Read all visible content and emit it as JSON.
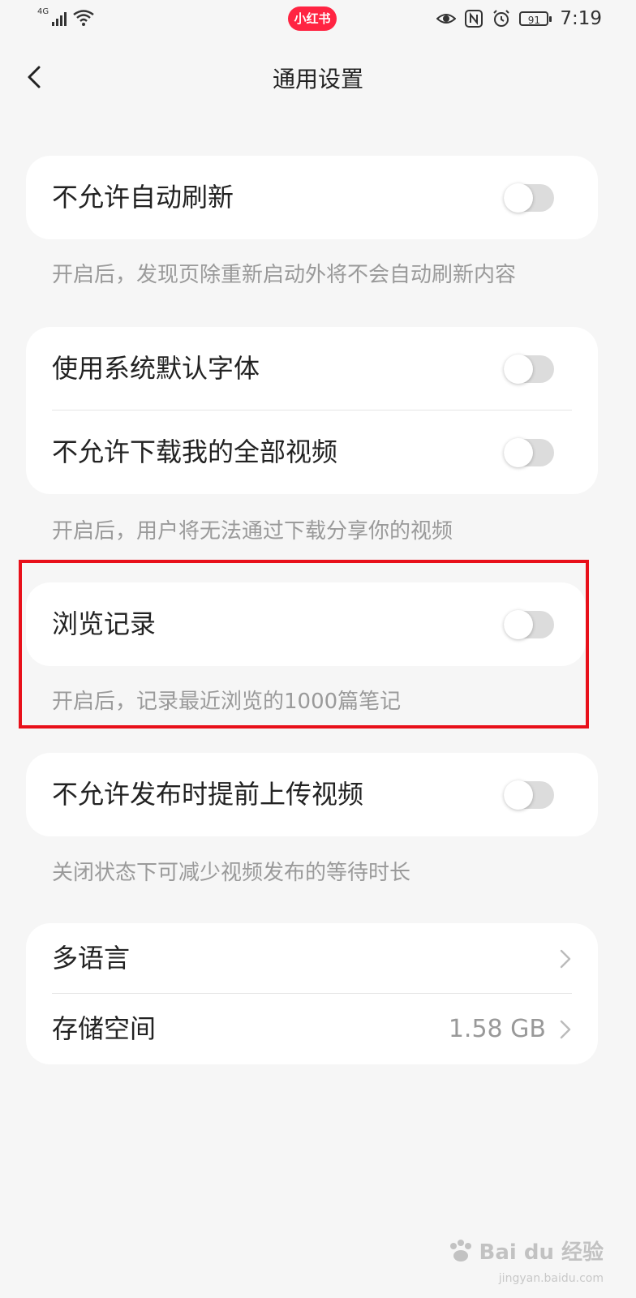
{
  "status_bar": {
    "network": "4G",
    "app_badge": "小红书",
    "battery": "91",
    "time": "7:19"
  },
  "header": {
    "title": "通用设置"
  },
  "settings": {
    "auto_refresh": {
      "label": "不允许自动刷新",
      "enabled": false,
      "desc": "开启后，发现页除重新启动外将不会自动刷新内容"
    },
    "system_font": {
      "label": "使用系统默认字体",
      "enabled": false
    },
    "video_download": {
      "label": "不允许下载我的全部视频",
      "enabled": false,
      "desc": "开启后，用户将无法通过下载分享你的视频"
    },
    "browse_history": {
      "label": "浏览记录",
      "enabled": false,
      "desc": "开启后，记录最近浏览的1000篇笔记"
    },
    "pre_upload": {
      "label": "不允许发布时提前上传视频",
      "enabled": false,
      "desc": "关闭状态下可减少视频发布的等待时长"
    },
    "language": {
      "label": "多语言"
    },
    "storage": {
      "label": "存储空间",
      "value": "1.58 GB"
    }
  },
  "colors": {
    "accent": "#ff2442",
    "highlight": "#e8101a",
    "background": "#f6f6f6"
  },
  "watermark": {
    "text": "Bai du 经验",
    "sub": "jingyan.baidu.com"
  }
}
